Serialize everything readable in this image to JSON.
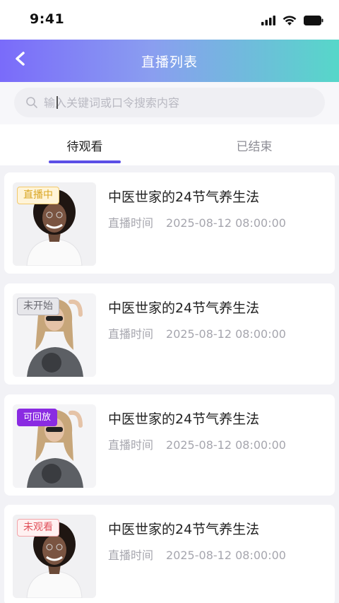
{
  "status_bar": {
    "time": "9:41"
  },
  "header": {
    "title": "直播列表"
  },
  "search": {
    "placeholder": "输入关键词或口令搜索内容"
  },
  "tabs": [
    {
      "label": "待观看",
      "active": true
    },
    {
      "label": "已结束",
      "active": false
    }
  ],
  "cards": [
    {
      "badge": "直播中",
      "badge_type": "live",
      "title": "中医世家的24节气养生法",
      "time_label": "直播时间",
      "time_value": "2025-08-12 08:00:00"
    },
    {
      "badge": "未开始",
      "badge_type": "notstarted",
      "title": "中医世家的24节气养生法",
      "time_label": "直播时间",
      "time_value": "2025-08-12 08:00:00"
    },
    {
      "badge": "可回放",
      "badge_type": "replay",
      "title": "中医世家的24节气养生法",
      "time_label": "直播时间",
      "time_value": "2025-08-12 08:00:00"
    },
    {
      "badge": "未观看",
      "badge_type": "unwatched",
      "title": "中医世家的24节气养生法",
      "time_label": "直播时间",
      "time_value": "2025-08-12 08:00:00"
    }
  ],
  "colors": {
    "accent": "#5b4fe6",
    "gradient_start": "#7a6bfa",
    "gradient_end": "#56d7c9"
  }
}
